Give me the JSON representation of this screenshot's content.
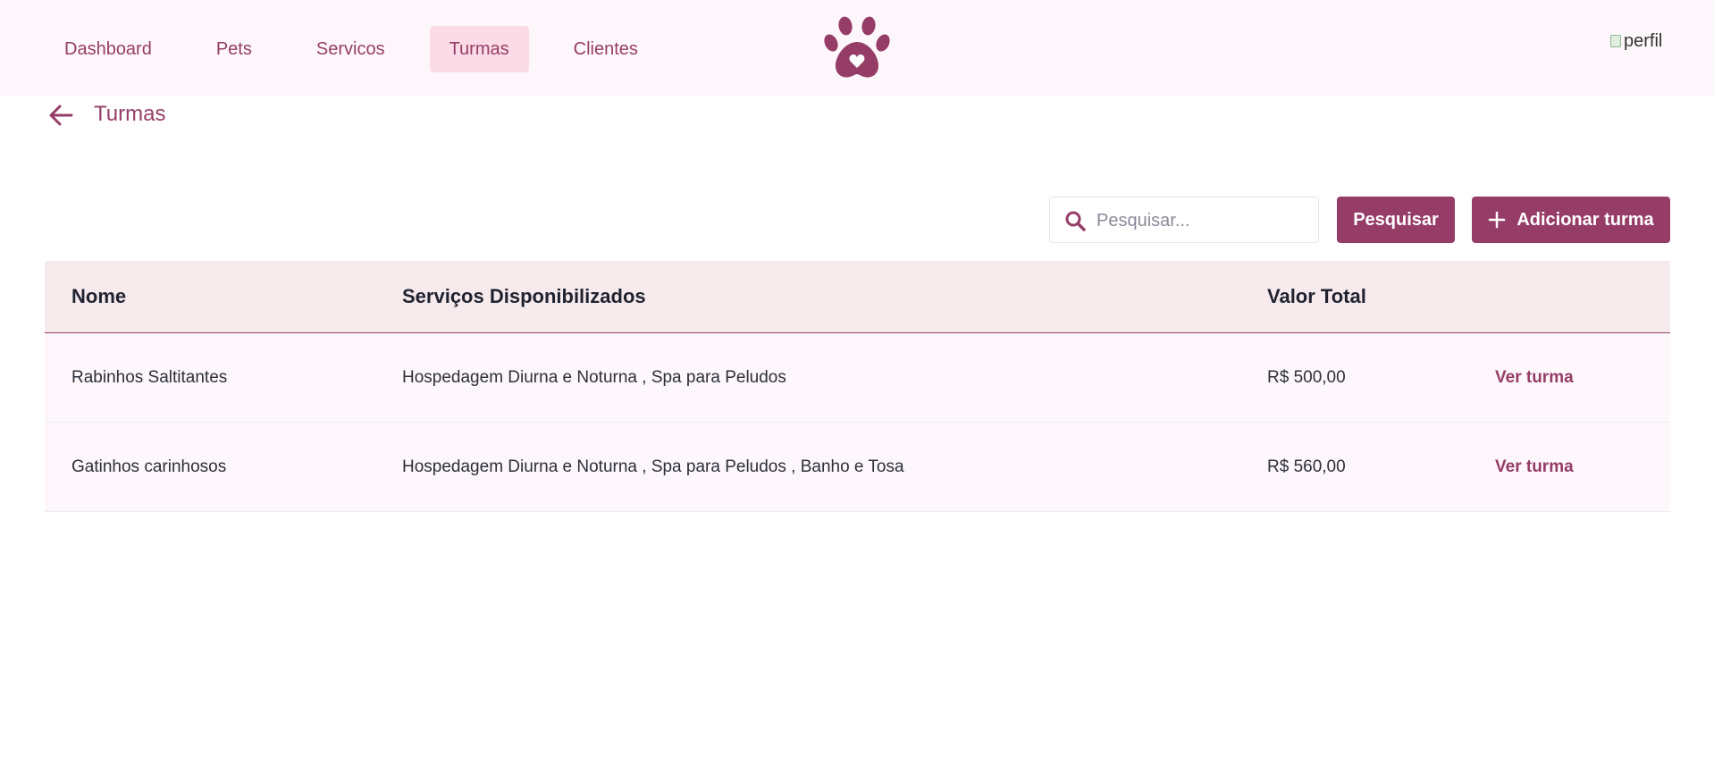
{
  "nav": {
    "items": [
      {
        "label": "Dashboard",
        "active": false
      },
      {
        "label": "Pets",
        "active": false
      },
      {
        "label": "Servicos",
        "active": false
      },
      {
        "label": "Turmas",
        "active": true
      },
      {
        "label": "Clientes",
        "active": false
      }
    ],
    "logo_icon": "paw-heart-icon",
    "avatar_alt": "perfil"
  },
  "page": {
    "back_icon": "arrow-left-icon",
    "title": "Turmas"
  },
  "toolbar": {
    "search_placeholder": "Pesquisar...",
    "search_value": "",
    "search_button": "Pesquisar",
    "add_button": "Adicionar turma",
    "add_icon": "plus-icon"
  },
  "table": {
    "headers": [
      "Nome",
      "Serviços Disponibilizados",
      "Valor Total"
    ],
    "rows": [
      {
        "nome": "Rabinhos Saltitantes",
        "servicos": "Hospedagem Diurna e Noturna , Spa para Peludos",
        "valor": "R$ 500,00",
        "action": "Ver turma"
      },
      {
        "nome": "Gatinhos carinhosos",
        "servicos": "Hospedagem Diurna e Noturna , Spa para Peludos , Banho e Tosa",
        "valor": "R$ 560,00",
        "action": "Ver turma"
      }
    ]
  },
  "colors": {
    "accent": "#963d67",
    "nav_active_bg": "#fbdce6",
    "header_bg": "#fdf7fb",
    "table_head_bg": "#f6eaec"
  }
}
